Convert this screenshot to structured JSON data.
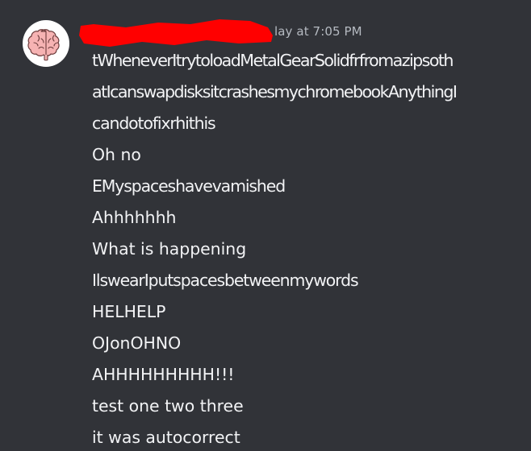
{
  "message": {
    "timestamp_fragment": "lay at 7:05 PM",
    "lines": [
      "tWheneverItrytoloadMetalGearSolidfrfromazipsoth",
      "atIcanswapdisksitcrashesmychromebookAnythingI",
      "candotofixrhithis",
      "Oh no",
      "EMyspaceshavevamished",
      "Ahhhhhhh",
      "What is happening",
      "IlswearIputspacesbetweenmywords",
      "HELHELP",
      "OJonOHNO",
      "AHHHHHHHHH!!!",
      "test one two three",
      "it was autocorrect"
    ]
  },
  "avatar": {
    "icon": "brain-icon",
    "color": "#f4a4a4"
  },
  "redaction": {
    "color": "#ff0000"
  },
  "colors": {
    "background": "#313338",
    "text": "#f2f3f5",
    "muted": "#b5bac1"
  }
}
